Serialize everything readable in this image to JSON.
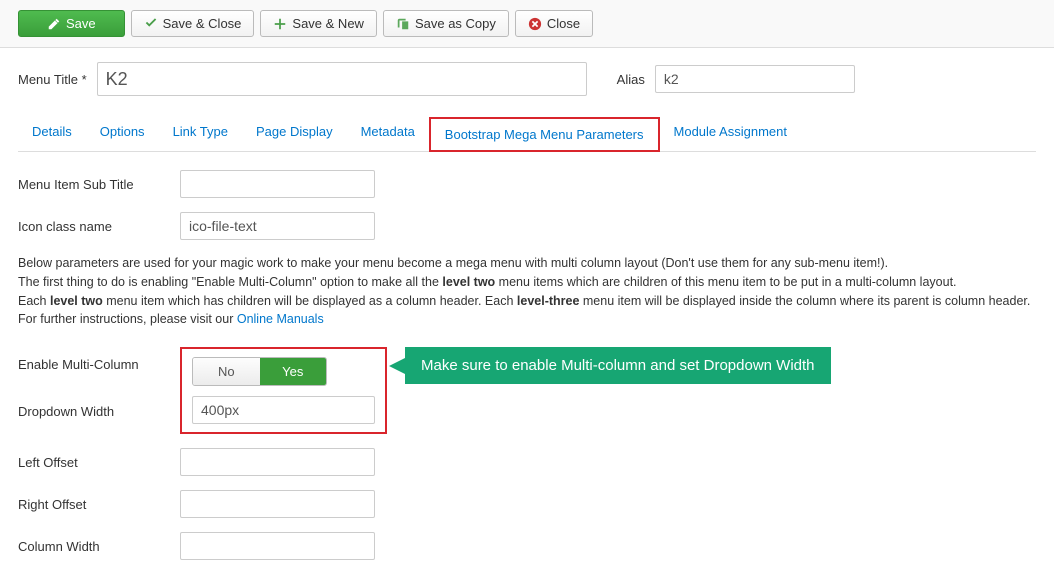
{
  "toolbar": {
    "save": "Save",
    "saveClose": "Save & Close",
    "saveNew": "Save & New",
    "saveCopy": "Save as Copy",
    "close": "Close"
  },
  "form": {
    "menuTitleLabel": "Menu Title *",
    "menuTitleValue": "K2",
    "aliasLabel": "Alias",
    "aliasValue": "k2"
  },
  "tabs": {
    "details": "Details",
    "options": "Options",
    "linkType": "Link Type",
    "pageDisplay": "Page Display",
    "metadata": "Metadata",
    "bootstrap": "Bootstrap Mega Menu Parameters",
    "moduleAssignment": "Module Assignment"
  },
  "fields": {
    "subTitleLabel": "Menu Item Sub Title",
    "subTitleValue": "",
    "iconClassLabel": "Icon class name",
    "iconClassValue": "ico-file-text",
    "enableMultiLabel": "Enable Multi-Column",
    "noLabel": "No",
    "yesLabel": "Yes",
    "dropdownWidthLabel": "Dropdown Width",
    "dropdownWidthValue": "400px",
    "leftOffsetLabel": "Left Offset",
    "leftOffsetValue": "",
    "rightOffsetLabel": "Right Offset",
    "rightOffsetValue": "",
    "columnWidthLabel": "Column Width",
    "columnWidthValue": ""
  },
  "desc": {
    "l1a": "Below parameters are used for your magic work to make your menu become a mega menu with multi column layout (Don't use them for any sub-menu item!).",
    "l2a": "The first thing to do is enabling \"Enable Multi-Column\" option to make all the ",
    "l2b": "level two",
    "l2c": " menu items which are children of this menu item to be put in a multi-column layout.",
    "l3a": "Each ",
    "l3b": "level two",
    "l3c": " menu item which has children will be displayed as a column header. Each ",
    "l3d": "level-three",
    "l3e": " menu item will be displayed inside the column where its parent is column header.",
    "l4a": "For further instructions, please visit our ",
    "l4b": "Online Manuals"
  },
  "callout": "Make sure to enable Multi-column and set Dropdown Width"
}
